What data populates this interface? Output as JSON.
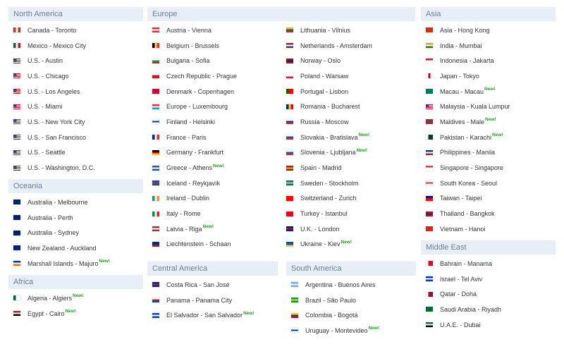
{
  "new_label": "New!",
  "regions": {
    "north_america": {
      "title": "North America",
      "items": [
        {
          "label": "Canada - Toronto",
          "flag": "canada-flag-icon",
          "c": [
            "#d52b1e",
            "#ffffff",
            "#d52b1e"
          ],
          "d": "v"
        },
        {
          "label": "Mexico - Mexico City",
          "flag": "mexico-flag-icon",
          "c": [
            "#006847",
            "#ffffff",
            "#ce1126"
          ],
          "d": "v"
        },
        {
          "label": "U.S. - Austin",
          "flag": "usa-flag-icon",
          "c": [
            "us"
          ]
        },
        {
          "label": "U.S. - Chicago",
          "flag": "usa-flag-icon",
          "c": [
            "us"
          ]
        },
        {
          "label": "U.S. - Los Angeles",
          "flag": "usa-flag-icon",
          "c": [
            "us"
          ]
        },
        {
          "label": "U.S. - Miami",
          "flag": "usa-flag-icon",
          "c": [
            "us"
          ]
        },
        {
          "label": "U.S. - New York City",
          "flag": "usa-flag-icon",
          "c": [
            "us"
          ]
        },
        {
          "label": "U.S. - San Francisco",
          "flag": "usa-flag-icon",
          "c": [
            "us"
          ]
        },
        {
          "label": "U.S. - Seattle",
          "flag": "usa-flag-icon",
          "c": [
            "us"
          ]
        },
        {
          "label": "U.S. - Washington, D.C.",
          "flag": "usa-flag-icon",
          "c": [
            "us"
          ]
        }
      ]
    },
    "oceania": {
      "title": "Oceania",
      "items": [
        {
          "label": "Australia - Melbourne",
          "flag": "australia-flag-icon",
          "c": [
            "#012169",
            "#012169",
            "#012169"
          ],
          "d": "h"
        },
        {
          "label": "Australia - Perth",
          "flag": "australia-flag-icon",
          "c": [
            "#012169",
            "#012169",
            "#012169"
          ],
          "d": "h"
        },
        {
          "label": "Australia - Sydney",
          "flag": "australia-flag-icon",
          "c": [
            "#012169",
            "#012169",
            "#012169"
          ],
          "d": "h"
        },
        {
          "label": "New Zealand - Auckland",
          "flag": "new-zealand-flag-icon",
          "c": [
            "#00247d",
            "#00247d",
            "#00247d"
          ],
          "d": "h"
        },
        {
          "label": "Marshall Islands - Majuro",
          "flag": "marshall-islands-flag-icon",
          "c": [
            "#003893",
            "#ffffff",
            "#dd7500"
          ],
          "d": "h",
          "new": true
        }
      ]
    },
    "africa": {
      "title": "Africa",
      "items": [
        {
          "label": "Algeria - Algiers",
          "flag": "algeria-flag-icon",
          "c": [
            "#006233",
            "#ffffff",
            "#ffffff"
          ],
          "d": "v",
          "new": true
        },
        {
          "label": "Egypt - Cairo",
          "flag": "egypt-flag-icon",
          "c": [
            "#ce1126",
            "#ffffff",
            "#000000"
          ],
          "d": "h",
          "new": true
        }
      ]
    },
    "europe": {
      "title": "Europe",
      "left": [
        {
          "label": "Austria - Vienna",
          "flag": "austria-flag-icon",
          "c": [
            "#ed2939",
            "#ffffff",
            "#ed2939"
          ],
          "d": "h"
        },
        {
          "label": "Belgium - Brussels",
          "flag": "belgium-flag-icon",
          "c": [
            "#000000",
            "#fae042",
            "#ed2939"
          ],
          "d": "v"
        },
        {
          "label": "Bulgaria - Sofia",
          "flag": "bulgaria-flag-icon",
          "c": [
            "#ffffff",
            "#00966e",
            "#d62612"
          ],
          "d": "h"
        },
        {
          "label": "Czech Republic - Prague",
          "flag": "czech-flag-icon",
          "c": [
            "#ffffff",
            "#d7141a",
            "#d7141a"
          ],
          "d": "h"
        },
        {
          "label": "Denmark - Copenhagen",
          "flag": "denmark-flag-icon",
          "c": [
            "#c60c30",
            "#c60c30",
            "#c60c30"
          ],
          "d": "h"
        },
        {
          "label": "Europe - Luxembourg",
          "flag": "luxembourg-flag-icon",
          "c": [
            "#ed2939",
            "#ffffff",
            "#00a1de"
          ],
          "d": "h"
        },
        {
          "label": "Finland - Helsinki",
          "flag": "finland-flag-icon",
          "c": [
            "#ffffff",
            "#003580",
            "#ffffff"
          ],
          "d": "h"
        },
        {
          "label": "France - Paris",
          "flag": "france-flag-icon",
          "c": [
            "#002395",
            "#ffffff",
            "#ed2939"
          ],
          "d": "v"
        },
        {
          "label": "Germany - Frankfurt",
          "flag": "germany-flag-icon",
          "c": [
            "#000000",
            "#dd0000",
            "#ffce00"
          ],
          "d": "h"
        },
        {
          "label": "Greece - Athens",
          "flag": "greece-flag-icon",
          "c": [
            "#0d5eaf",
            "#ffffff",
            "#0d5eaf"
          ],
          "d": "h",
          "new": true
        },
        {
          "label": "Iceland - Reykjavík",
          "flag": "iceland-flag-icon",
          "c": [
            "#02529c",
            "#dc1e35",
            "#02529c"
          ],
          "d": "h"
        },
        {
          "label": "Ireland - Dublin",
          "flag": "ireland-flag-icon",
          "c": [
            "#169b62",
            "#ffffff",
            "#ff883e"
          ],
          "d": "v"
        },
        {
          "label": "Italy - Rome",
          "flag": "italy-flag-icon",
          "c": [
            "#009246",
            "#ffffff",
            "#ce2b37"
          ],
          "d": "v"
        },
        {
          "label": "Latvia - Riga",
          "flag": "latvia-flag-icon",
          "c": [
            "#9e3039",
            "#ffffff",
            "#9e3039"
          ],
          "d": "h",
          "new": true
        },
        {
          "label": "Liechtenstein - Schaan",
          "flag": "liechtenstein-flag-icon",
          "c": [
            "#002b7f",
            "#002b7f",
            "#ce1126"
          ],
          "d": "h"
        }
      ],
      "right": [
        {
          "label": "Lithuania - Vilnius",
          "flag": "lithuania-flag-icon",
          "c": [
            "#fdb913",
            "#006a44",
            "#c1272d"
          ],
          "d": "h"
        },
        {
          "label": "Netherlands - Amsterdam",
          "flag": "netherlands-flag-icon",
          "c": [
            "#ae1c28",
            "#ffffff",
            "#21468b"
          ],
          "d": "h"
        },
        {
          "label": "Norway - Oslo",
          "flag": "norway-flag-icon",
          "c": [
            "#ba0c2f",
            "#00205b",
            "#ba0c2f"
          ],
          "d": "h"
        },
        {
          "label": "Poland - Warsaw",
          "flag": "poland-flag-icon",
          "c": [
            "#ffffff",
            "#ffffff",
            "#dc143c"
          ],
          "d": "h"
        },
        {
          "label": "Portugal - Lisbon",
          "flag": "portugal-flag-icon",
          "c": [
            "#006600",
            "#ff0000",
            "#ff0000"
          ],
          "d": "v"
        },
        {
          "label": "Romania - Bucharest",
          "flag": "romania-flag-icon",
          "c": [
            "#002b7f",
            "#fcd116",
            "#ce1126"
          ],
          "d": "v"
        },
        {
          "label": "Russia - Moscow",
          "flag": "russia-flag-icon",
          "c": [
            "#ffffff",
            "#0039a6",
            "#d52b1e"
          ],
          "d": "h"
        },
        {
          "label": "Slovakia - Bratislava",
          "flag": "slovakia-flag-icon",
          "c": [
            "#ffffff",
            "#0b4ea2",
            "#ee1c25"
          ],
          "d": "h",
          "new": true
        },
        {
          "label": "Slovenia - Ljubljana",
          "flag": "slovenia-flag-icon",
          "c": [
            "#ffffff",
            "#005da4",
            "#ed1c24"
          ],
          "d": "h",
          "new": true
        },
        {
          "label": "Spain - Madrid",
          "flag": "spain-flag-icon",
          "c": [
            "#aa151b",
            "#f1bf00",
            "#aa151b"
          ],
          "d": "h"
        },
        {
          "label": "Sweden - Stockholm",
          "flag": "sweden-flag-icon",
          "c": [
            "#006aa7",
            "#fecc00",
            "#006aa7"
          ],
          "d": "h"
        },
        {
          "label": "Switzerland - Zurich",
          "flag": "switzerland-flag-icon",
          "c": [
            "#ff0000",
            "#ff0000",
            "#ff0000"
          ],
          "d": "h"
        },
        {
          "label": "Turkey - Istanbul",
          "flag": "turkey-flag-icon",
          "c": [
            "#e30a17",
            "#e30a17",
            "#e30a17"
          ],
          "d": "h"
        },
        {
          "label": "U.K. - London",
          "flag": "uk-flag-icon",
          "c": [
            "#012169",
            "#c8102e",
            "#012169"
          ],
          "d": "h"
        },
        {
          "label": "Ukraine - Kiev",
          "flag": "ukraine-flag-icon",
          "c": [
            "#0057b7",
            "#0057b7",
            "#ffd700"
          ],
          "d": "h",
          "new": true
        }
      ]
    },
    "central_america": {
      "title": "Central America",
      "items": [
        {
          "label": "Costa Rica - San José",
          "flag": "costa-rica-flag-icon",
          "c": [
            "#002b7f",
            "#ce1126",
            "#002b7f"
          ],
          "d": "h"
        },
        {
          "label": "Panama - Panama City",
          "flag": "panama-flag-icon",
          "c": [
            "#ffffff",
            "#da121a",
            "#005293"
          ],
          "d": "h"
        },
        {
          "label": "El Salvador - San Salvador",
          "flag": "el-salvador-flag-icon",
          "c": [
            "#0047ab",
            "#ffffff",
            "#0047ab"
          ],
          "d": "h",
          "new": true
        }
      ]
    },
    "south_america": {
      "title": "South America",
      "items": [
        {
          "label": "Argentina - Buenos Aires",
          "flag": "argentina-flag-icon",
          "c": [
            "#74acdf",
            "#ffffff",
            "#74acdf"
          ],
          "d": "h"
        },
        {
          "label": "Brazil - São Paulo",
          "flag": "brazil-flag-icon",
          "c": [
            "#009c3b",
            "#ffdf00",
            "#009c3b"
          ],
          "d": "h"
        },
        {
          "label": "Colombia - Bogotá",
          "flag": "colombia-flag-icon",
          "c": [
            "#fcd116",
            "#003893",
            "#ce1126"
          ],
          "d": "h"
        },
        {
          "label": "Uruguay - Montevideo",
          "flag": "uruguay-flag-icon",
          "c": [
            "#ffffff",
            "#0038a8",
            "#ffffff"
          ],
          "d": "h",
          "new": true
        }
      ]
    },
    "asia": {
      "title": "Asia",
      "items": [
        {
          "label": "Asia - Hong Kong",
          "flag": "hong-kong-flag-icon",
          "c": [
            "#de2910",
            "#de2910",
            "#de2910"
          ],
          "d": "h"
        },
        {
          "label": "India - Mumbai",
          "flag": "india-flag-icon",
          "c": [
            "#ff9933",
            "#ffffff",
            "#138808"
          ],
          "d": "h"
        },
        {
          "label": "Indonesia - Jakarta",
          "flag": "indonesia-flag-icon",
          "c": [
            "#ce1126",
            "#ffffff",
            "#ffffff"
          ],
          "d": "h"
        },
        {
          "label": "Japan - Tokyo",
          "flag": "japan-flag-icon",
          "c": [
            "#ffffff",
            "#bc002d",
            "#ffffff"
          ],
          "d": "v"
        },
        {
          "label": "Macau - Macau",
          "flag": "macau-flag-icon",
          "c": [
            "#00785e",
            "#00785e",
            "#00785e"
          ],
          "d": "h",
          "new": true
        },
        {
          "label": "Malaysia - Kuala Lumpur",
          "flag": "malaysia-flag-icon",
          "c": [
            "us"
          ]
        },
        {
          "label": "Maldives - Male",
          "flag": "maldives-flag-icon",
          "c": [
            "#d21034",
            "#007e3a",
            "#d21034"
          ],
          "d": "v",
          "new": true
        },
        {
          "label": "Pakistan - Karachi",
          "flag": "pakistan-flag-icon",
          "c": [
            "#ffffff",
            "#01411c",
            "#01411c"
          ],
          "d": "v",
          "new": true
        },
        {
          "label": "Philippines - Manila",
          "flag": "philippines-flag-icon",
          "c": [
            "#0038a8",
            "#ffffff",
            "#ce1126"
          ],
          "d": "h"
        },
        {
          "label": "Singapore - Singapore",
          "flag": "singapore-flag-icon",
          "c": [
            "#ef3340",
            "#ffffff",
            "#ffffff"
          ],
          "d": "h"
        },
        {
          "label": "South Korea - Seoul",
          "flag": "south-korea-flag-icon",
          "c": [
            "#ffffff",
            "#cd2e3a",
            "#ffffff"
          ],
          "d": "h"
        },
        {
          "label": "Taiwan - Taipei",
          "flag": "taiwan-flag-icon",
          "c": [
            "#000095",
            "#fe0000",
            "#fe0000"
          ],
          "d": "h"
        },
        {
          "label": "Thailand - Bangkok",
          "flag": "thailand-flag-icon",
          "c": [
            "#a51931",
            "#2d2a4a",
            "#a51931"
          ],
          "d": "h"
        },
        {
          "label": "Vietnam - Hanoi",
          "flag": "vietnam-flag-icon",
          "c": [
            "#da251d",
            "#da251d",
            "#da251d"
          ],
          "d": "h"
        }
      ]
    },
    "middle_east": {
      "title": "Middle East",
      "items": [
        {
          "label": "Bahrain - Manama",
          "flag": "bahrain-flag-icon",
          "c": [
            "#ffffff",
            "#ce1126",
            "#ce1126"
          ],
          "d": "v"
        },
        {
          "label": "Israel - Tel Aviv",
          "flag": "israel-flag-icon",
          "c": [
            "#0038b8",
            "#ffffff",
            "#0038b8"
          ],
          "d": "h"
        },
        {
          "label": "Qatar - Doha",
          "flag": "qatar-flag-icon",
          "c": [
            "#ffffff",
            "#8a1538",
            "#8a1538"
          ],
          "d": "v"
        },
        {
          "label": "Saudi Arabia - Riyadh",
          "flag": "saudi-arabia-flag-icon",
          "c": [
            "#006c35",
            "#006c35",
            "#006c35"
          ],
          "d": "h"
        },
        {
          "label": "U.A.E. - Dubai",
          "flag": "uae-flag-icon",
          "c": [
            "#00732f",
            "#ffffff",
            "#000000"
          ],
          "d": "h"
        }
      ]
    }
  }
}
